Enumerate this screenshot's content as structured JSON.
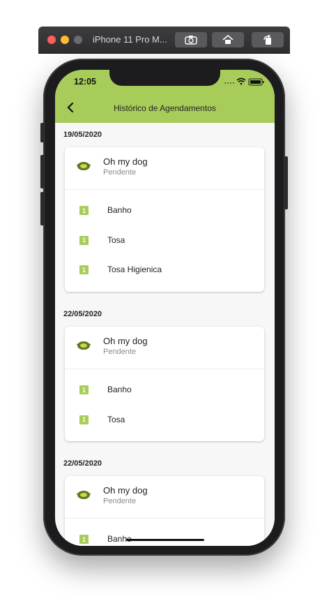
{
  "simulator": {
    "title": "iPhone 11 Pro M...",
    "icons": [
      "camera-icon",
      "home-icon",
      "rotate-icon"
    ]
  },
  "status_bar": {
    "time": "12:05"
  },
  "app_bar": {
    "title": "Histórico de Agendamentos",
    "color": "#a8cc5a"
  },
  "sections": [
    {
      "date": "19/05/2020",
      "shop": "Oh my dog",
      "status": "Pendente",
      "services": [
        {
          "qty": "1",
          "name": "Banho"
        },
        {
          "qty": "1",
          "name": "Tosa"
        },
        {
          "qty": "1",
          "name": "Tosa Higienica"
        }
      ]
    },
    {
      "date": "22/05/2020",
      "shop": "Oh my dog",
      "status": "Pendente",
      "services": [
        {
          "qty": "1",
          "name": "Banho"
        },
        {
          "qty": "1",
          "name": "Tosa"
        }
      ]
    },
    {
      "date": "22/05/2020",
      "shop": "Oh my dog",
      "status": "Pendente",
      "services": [
        {
          "qty": "1",
          "name": "Banho"
        }
      ]
    }
  ]
}
